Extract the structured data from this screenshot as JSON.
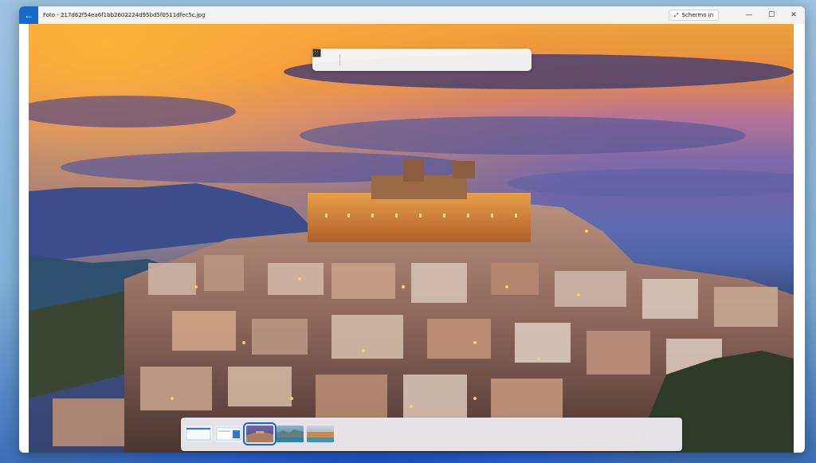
{
  "window": {
    "title": "Foto - 217d62f54ea6f1bb2602224d95bd5f0511dfec5c.jpg",
    "fullscreen_label": "Schermo in",
    "controls": {
      "minimize": "—",
      "maximize": "☐",
      "close": "✕"
    },
    "accent": "#1769c9"
  },
  "toolbar": {
    "buttons": [
      {
        "name": "gallery-icon"
      },
      {
        "name": "zoom-in-icon"
      },
      {
        "name": "zoom-out-icon"
      },
      {
        "name": "rotate-icon"
      },
      {
        "name": "edit-image-icon"
      },
      {
        "name": "draw-icon"
      },
      {
        "name": "delete-icon"
      },
      {
        "name": "favorite-icon"
      },
      {
        "name": "info-icon"
      },
      {
        "name": "more-icon"
      }
    ]
  },
  "filmstrip": {
    "thumbnails": 5,
    "selected_index": 2
  }
}
